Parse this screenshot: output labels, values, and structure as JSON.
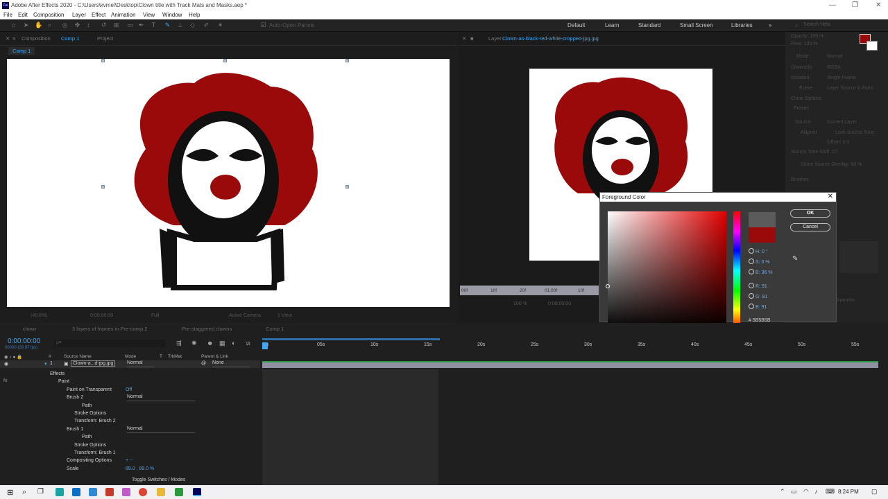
{
  "window": {
    "title": "Adobe After Effects 2020 - C:\\Users\\kvmel\\Desktop\\Clown title with Track Mats and Masks.aep *",
    "logo": "Ae"
  },
  "menu": [
    "File",
    "Edit",
    "Composition",
    "Layer",
    "Effect",
    "Animation",
    "View",
    "Window",
    "Help"
  ],
  "toolbar": {
    "auto_open": "Auto-Open Panels",
    "workspaces": [
      "Default",
      "Learn",
      "Standard",
      "Small Screen",
      "Libraries"
    ],
    "search": "Search Help"
  },
  "comp_panel": {
    "tab": "Composition",
    "tab_name": "Comp 1",
    "tab2": "Project",
    "subtab": "Comp 1",
    "footer_zoom": "(49.8%)",
    "footer_time": "0:00:00:00",
    "footer_res": "Full",
    "footer_cam": "Active Camera",
    "footer_view": "1 View"
  },
  "layer_panel": {
    "tab": "Layer",
    "tab_name": "Clown-as-black-red-white-cropped-jpg.jpg",
    "ruler": [
      "00f",
      "10f",
      "20f",
      "01:00f",
      "10f"
    ],
    "footer_time": "0:00:00:00",
    "footer_zoom": "100 %"
  },
  "right_panel": {
    "opacity": "Opacity: 100 %",
    "flow": "Flow: 100 %",
    "mode": "Mode:",
    "mode_val": "Normal",
    "channels": "Channels:",
    "channels_val": "RGBA",
    "duration": "Duration:",
    "duration_val": "Single Frame",
    "erase": "Erase:",
    "erase_val": "Layer Source & Paint",
    "clone": "Clone Options",
    "preset": "Preset:",
    "source": "Source:",
    "source_val": "Current Layer",
    "aligned": "Aligned",
    "lock": "Lock Source Time",
    "offset": "Offset: 0     0",
    "src_time": "Source Time Shift: 0 f",
    "overlay": "Clone Source Overlay: 50 %",
    "brushes": "Brushes",
    "diameter": "Diameter"
  },
  "color_dialog": {
    "title": "Foreground Color",
    "ok": "OK",
    "cancel": "Cancel",
    "h": "H: 0 °",
    "s": "S: 0 %",
    "b": "B: 36 %",
    "r": "R: 91",
    "g": "G: 91",
    "bl": "B: 91",
    "hex": "5B5B5B",
    "new_color": "#5b5b5b",
    "old_color": "#9b0a0a"
  },
  "timeline": {
    "tabs": [
      "clown",
      "3 layers of frames in Pre-comp 2",
      "Pre staggered clowns",
      "Comp 1"
    ],
    "timecode": "0:00:00:00",
    "fps": "00000 (29.97 fps)",
    "search_placeholder": "ρ▾",
    "columns": {
      "num": "#",
      "source": "Source Name",
      "mode": "Mode",
      "t": "T",
      "trkmat": "TrkMat",
      "parent": "Parent & Link"
    },
    "layer": {
      "num": "1",
      "name": "Clown-a...d-jpg.jpg",
      "mode": "Normal",
      "parent": "None"
    },
    "props": [
      {
        "label": "Effects",
        "indent": 72
      },
      {
        "label": "Paint",
        "indent": 84
      },
      {
        "label": "Paint on Transparent",
        "indent": 96,
        "value": "Off"
      },
      {
        "label": "Brush 2",
        "indent": 96,
        "dropdown": "Normal"
      },
      {
        "label": "Path",
        "indent": 118
      },
      {
        "label": "Stroke Options",
        "indent": 107
      },
      {
        "label": "Transform: Brush 2",
        "indent": 107
      },
      {
        "label": "Brush 1",
        "indent": 96,
        "dropdown": "Normal"
      },
      {
        "label": "Path",
        "indent": 118
      },
      {
        "label": "Stroke Options",
        "indent": 107
      },
      {
        "label": "Transform: Brush 1",
        "indent": 107
      },
      {
        "label": "Compositing Options",
        "indent": 96,
        "value": "+ −"
      },
      {
        "label": "Scale",
        "indent": 96,
        "value": "89.0 , 89.0 %"
      }
    ],
    "ruler": [
      "0s",
      "05s",
      "10s",
      "15s",
      "20s",
      "25s",
      "30s",
      "35s",
      "40s",
      "45s",
      "50s",
      "55s"
    ],
    "toggle": "Toggle Switches / Modes"
  },
  "taskbar": {
    "time": "8:24 PM"
  }
}
